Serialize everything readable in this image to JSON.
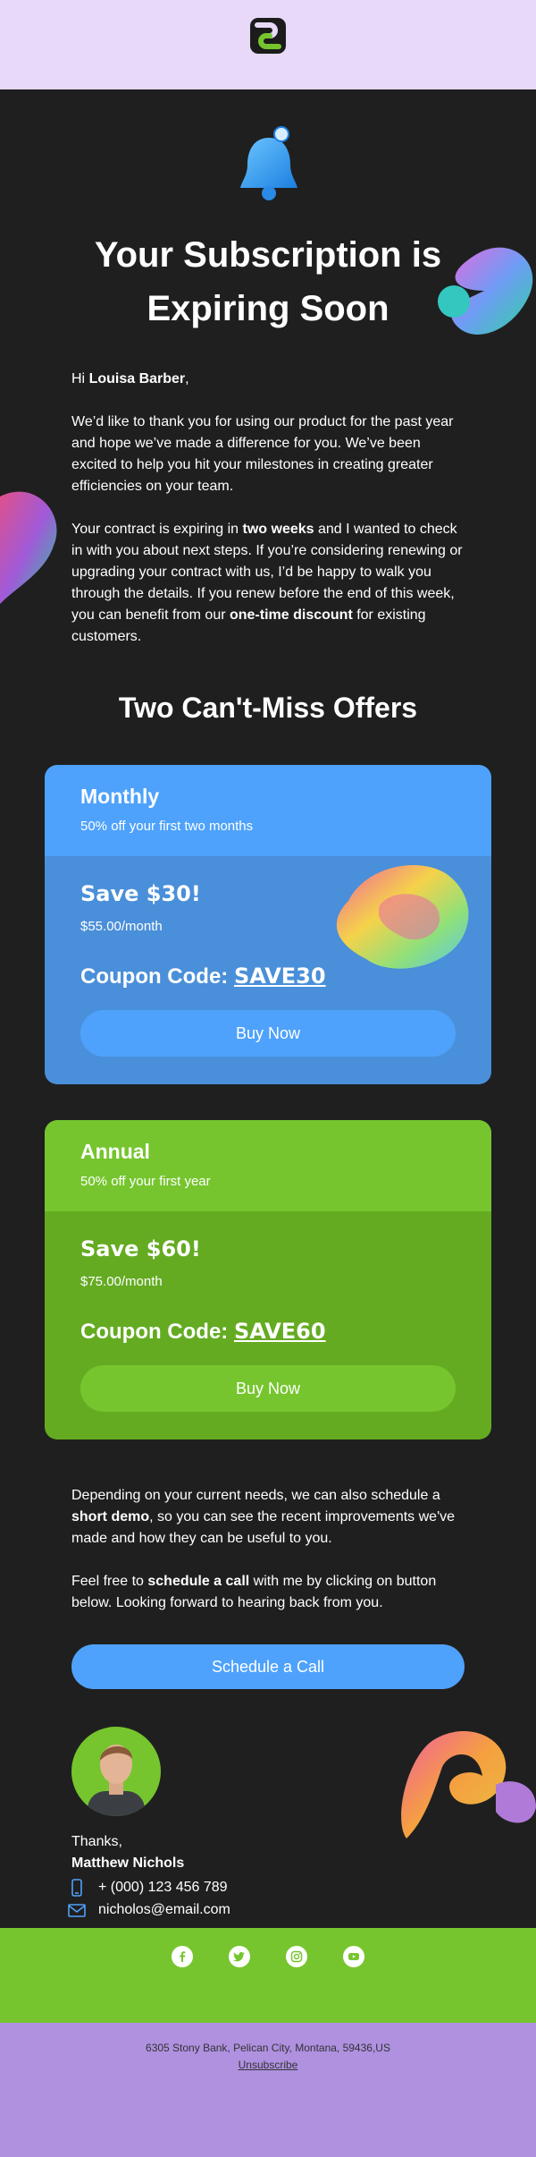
{
  "colors": {
    "dark_bg": "#1f1f1f",
    "top_band": "#e7d9f7",
    "blue": "#4ea2fb",
    "green": "#76c52e",
    "footer": "#af91e0"
  },
  "icons": [
    "brand-logo-icon",
    "bell-icon",
    "phone-icon",
    "mail-icon",
    "facebook-icon",
    "twitter-icon",
    "instagram-icon",
    "youtube-icon"
  ],
  "header": {
    "title": "Your Subscription is Expiring Soon"
  },
  "greeting": {
    "hi": "Hi ",
    "name": "Louisa Barber",
    "comma": ","
  },
  "intro": "We’d like to thank you for using our product for the past year and hope we’ve made a difference for you. We’ve been excited to help you hit your milestones in creating greater efficiencies on your team.",
  "contract": {
    "p1": "Your contract is expiring in ",
    "b1": "two weeks",
    "p2": " and I wanted to check in with you about next steps. If you’re considering renewing or upgrading your contract with us, I’d be happy to walk you through the details. If you renew before the end of this week, you can benefit from our ",
    "b2": "one-time discount",
    "p3": " for existing customers."
  },
  "offers": {
    "title": "Two Can't-Miss Offers",
    "monthly": {
      "name": "Monthly",
      "sub": "50% off your first two months",
      "save": "Save $30!",
      "price": "$55.00/month",
      "coupon_label": "Coupon Code: ",
      "coupon_code": "SAVE30",
      "button": "Buy Now"
    },
    "annual": {
      "name": "Annual",
      "sub": "50% off your first year",
      "save": "Save $60!",
      "price": "$75.00/month",
      "coupon_label": "Coupon Code: ",
      "coupon_code": "SAVE60",
      "button": "Buy Now"
    }
  },
  "demo": {
    "p1": "Depending on your current needs, we can also schedule a ",
    "b1": "short demo",
    "p2": ", so you can see the recent improvements we've made and how they can be useful to you."
  },
  "call": {
    "p1": "Feel free to ",
    "b1": "schedule a call",
    "p2": " with me by clicking on button below. Looking forward to hearing back from you."
  },
  "cta": "Schedule a Call",
  "signature": {
    "thanks": "Thanks,",
    "name": "Matthew Nichols",
    "phone": "+ (000) 123 456 789",
    "email": "nicholos@email.com"
  },
  "footer": {
    "address": "6305 Stony Bank, Pelican City, Montana, 59436,US",
    "unsubscribe": "Unsubscribe"
  }
}
